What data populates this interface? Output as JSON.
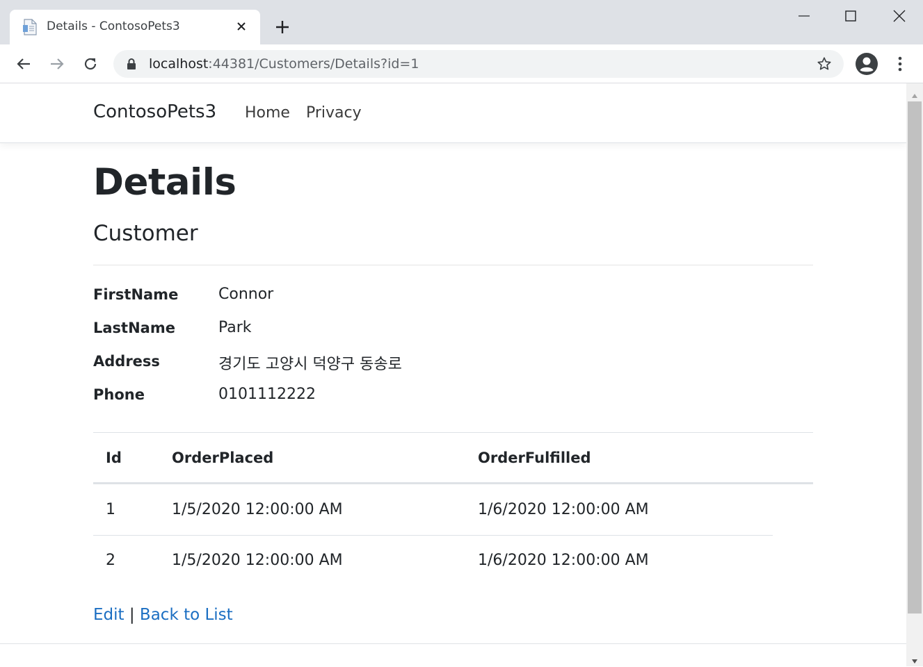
{
  "browser": {
    "tab_title": "Details - ContosoPets3",
    "url_host": "localhost",
    "url_rest": ":44381/Customers/Details?id=1",
    "icons": [
      "file-icon",
      "close-icon",
      "plus-icon",
      "minimize-icon",
      "maximize-icon",
      "window-close-icon",
      "back-arrow-icon",
      "forward-arrow-icon",
      "reload-icon",
      "lock-icon",
      "star-icon",
      "profile-icon",
      "more-vert-icon"
    ]
  },
  "nav": {
    "brand": "ContosoPets3",
    "links": [
      "Home",
      "Privacy"
    ]
  },
  "page": {
    "title": "Details",
    "subtitle": "Customer"
  },
  "customer": {
    "fields": [
      {
        "label": "FirstName",
        "value": "Connor"
      },
      {
        "label": "LastName",
        "value": "Park"
      },
      {
        "label": "Address",
        "value": "경기도 고양시 덕양구 동송로"
      },
      {
        "label": "Phone",
        "value": "0101112222"
      }
    ]
  },
  "orders": {
    "headers": [
      "Id",
      "OrderPlaced",
      "OrderFulfilled"
    ],
    "rows": [
      {
        "id": "1",
        "placed": "1/5/2020 12:00:00 AM",
        "fulfilled": "1/6/2020 12:00:00 AM"
      },
      {
        "id": "2",
        "placed": "1/5/2020 12:00:00 AM",
        "fulfilled": "1/6/2020 12:00:00 AM"
      }
    ]
  },
  "actions": {
    "edit": "Edit",
    "separator": "|",
    "back": "Back to List"
  },
  "colors": {
    "link": "#1b6ec2",
    "text": "#212529",
    "chrome": "#dee1e6",
    "omnibox": "#f1f3f4"
  }
}
